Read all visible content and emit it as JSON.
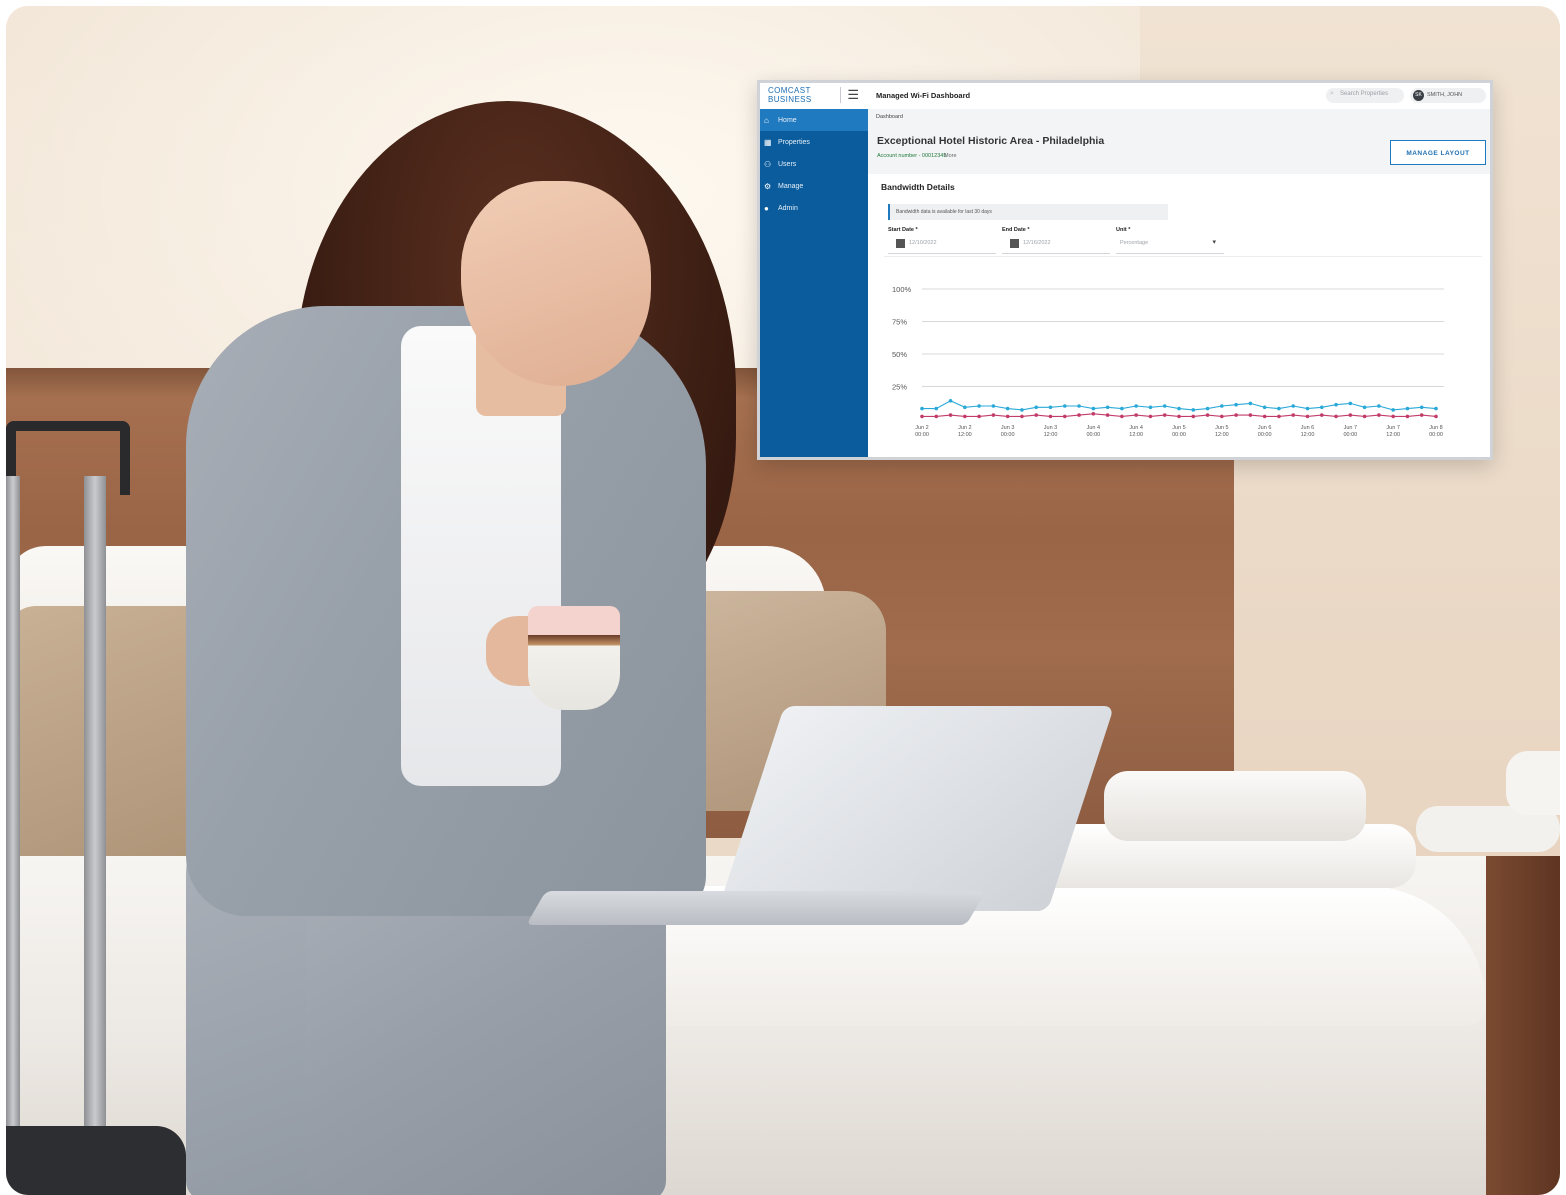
{
  "dashboard": {
    "brand": "COMCAST BUSINESS",
    "menu_icon": "hamburger-icon",
    "title": "Managed Wi-Fi Dashboard",
    "search_placeholder": "Search Properties",
    "user": {
      "initials": "SK",
      "name": "SMITH, JOHN"
    },
    "breadcrumb": "Dashboard",
    "nav": [
      {
        "label": "Home",
        "icon": "home-icon",
        "active": true
      },
      {
        "label": "Properties",
        "icon": "building-icon",
        "active": false
      },
      {
        "label": "Users",
        "icon": "users-icon",
        "active": false
      },
      {
        "label": "Manage",
        "icon": "gear-icon",
        "active": false
      },
      {
        "label": "Admin",
        "icon": "admin-icon",
        "active": false
      }
    ],
    "property": {
      "name": "Exceptional Hotel Historic Area - Philadelphia",
      "account": "Account number - 00012345",
      "more": "More",
      "manage_button": "MANAGE LAYOUT"
    },
    "bandwidth": {
      "title": "Bandwidth Details",
      "info": "Bandwidth data is available for last 30 days",
      "start_label": "Start Date *",
      "start_value": "12/10/2022",
      "end_label": "End Date *",
      "end_value": "12/16/2022",
      "unit_label": "Unit *",
      "unit_value": "Percentage"
    }
  },
  "chart_data": {
    "type": "line",
    "ylim": [
      0,
      100
    ],
    "y_ticks": [
      "100%",
      "75%",
      "50%",
      "25%"
    ],
    "x_labels": [
      [
        "Jun 2",
        "00:00"
      ],
      [
        "Jun 2",
        "12:00"
      ],
      [
        "Jun 3",
        "00:00"
      ],
      [
        "Jun 3",
        "12:00"
      ],
      [
        "Jun 4",
        "00:00"
      ],
      [
        "Jun 4",
        "12:00"
      ],
      [
        "Jun 5",
        "00:00"
      ],
      [
        "Jun 5",
        "12:00"
      ],
      [
        "Jun 6",
        "00:00"
      ],
      [
        "Jun 6",
        "12:00"
      ],
      [
        "Jun 7",
        "00:00"
      ],
      [
        "Jun 7",
        "12:00"
      ],
      [
        "Jun 8",
        "00:00"
      ]
    ],
    "series": [
      {
        "color": "#2aa9d8",
        "values": [
          8,
          8,
          14,
          9,
          10,
          10,
          8,
          7,
          9,
          9,
          10,
          10,
          8,
          9,
          8,
          10,
          9,
          10,
          8,
          7,
          8,
          10,
          11,
          12,
          9,
          8,
          10,
          8,
          9,
          11,
          12,
          9,
          10,
          7,
          8,
          9,
          8
        ]
      },
      {
        "color": "#c23c6a",
        "values": [
          2,
          2,
          3,
          2,
          2,
          3,
          2,
          2,
          3,
          2,
          2,
          3,
          4,
          3,
          2,
          3,
          2,
          3,
          2,
          2,
          3,
          2,
          3,
          3,
          2,
          2,
          3,
          2,
          3,
          2,
          3,
          2,
          3,
          2,
          2,
          3,
          2
        ]
      }
    ]
  }
}
